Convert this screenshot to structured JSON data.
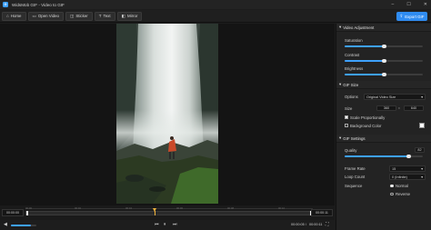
{
  "window": {
    "title": "WidsMob GIF - Video to GIF",
    "logo_letter": "G"
  },
  "toolbar": {
    "buttons": [
      {
        "icon": "home-icon",
        "label": "Home"
      },
      {
        "icon": "open-video-icon",
        "label": "Open Video"
      },
      {
        "icon": "sticker-icon",
        "label": "Sticker"
      },
      {
        "icon": "text-icon",
        "label": "Text"
      },
      {
        "icon": "mirror-icon",
        "label": "Mirror"
      }
    ],
    "export_label": "Export GIF"
  },
  "panel": {
    "video_adjustment": {
      "title": "Video Adjustment",
      "saturation": {
        "label": "Saturation",
        "value": 0.5
      },
      "contrast": {
        "label": "Contrast",
        "value": 0.5
      },
      "brightness": {
        "label": "Brightness",
        "value": 0.5
      }
    },
    "gif_size": {
      "title": "GIF Size",
      "options_label": "Options",
      "options_value": "Original Video Size",
      "size_label": "Size",
      "width": "360",
      "height": "640",
      "scale_label": "Scale Proportionally",
      "bg_label": "Background Color"
    },
    "gif_settings": {
      "title": "GIF Settings",
      "quality_label": "Quality",
      "quality_value": "82",
      "quality_level": 0.82,
      "frame_rate_label": "Frame Rate",
      "frame_rate_value": "15",
      "loop_label": "Loop Count",
      "loop_value": "0 (Infinite)",
      "sequence_label": "Sequence",
      "sequence_options": [
        "Normal",
        "Reverse"
      ]
    }
  },
  "timeline": {
    "start_time": "00:00:00",
    "end_time": "00:00:11",
    "ticks": [
      "00:00",
      "00:02",
      "00:04",
      "00:06",
      "00:08",
      "00:10"
    ],
    "playhead_fraction": 0.45
  },
  "player": {
    "current_time": "00:00:05",
    "total_time": "00:00:11",
    "volume": 0.8
  }
}
